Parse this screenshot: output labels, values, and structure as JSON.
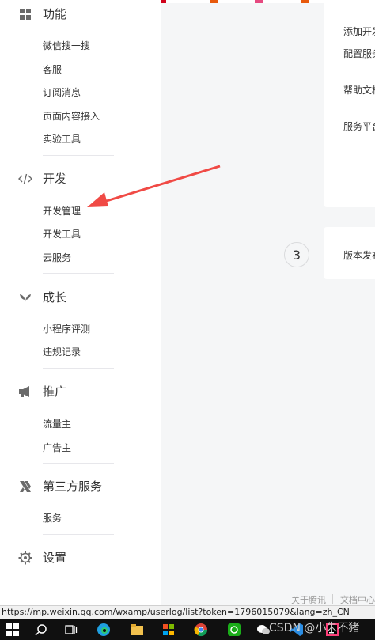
{
  "sidebar": {
    "groups": [
      {
        "label": "功能",
        "icon": "grid-icon",
        "items": [
          "微信搜一搜",
          "客服",
          "订阅消息",
          "页面内容接入",
          "实验工具"
        ]
      },
      {
        "label": "开发",
        "icon": "code-icon",
        "items": [
          "开发管理",
          "开发工具",
          "云服务"
        ]
      },
      {
        "label": "成长",
        "icon": "sprout-icon",
        "items": [
          "小程序评测",
          "违规记录"
        ]
      },
      {
        "label": "推广",
        "icon": "megaphone-icon",
        "items": [
          "流量主",
          "广告主"
        ]
      },
      {
        "label": "第三方服务",
        "icon": "third-party-icon",
        "items": [
          "服务"
        ]
      },
      {
        "label": "设置",
        "icon": "gear-icon",
        "items": []
      }
    ]
  },
  "main": {
    "card1": {
      "lines": [
        "添加开发",
        "配置服务",
        "帮助文档",
        "服务平台"
      ]
    },
    "step3": {
      "number": "3",
      "label": "版本发布"
    }
  },
  "footer": {
    "about": "关于腾讯",
    "docs": "文档中心"
  },
  "status_url": "https://mp.weixin.qq.com/wxamp/userlog/list?token=1796015079&lang=zh_CN",
  "watermark": "CSDN @小朱不猪",
  "colors": {
    "accent": "#f04a45",
    "sidebar_bg": "#ffffff",
    "page_bg": "#f5f6f7",
    "taskbar": "#101010"
  }
}
